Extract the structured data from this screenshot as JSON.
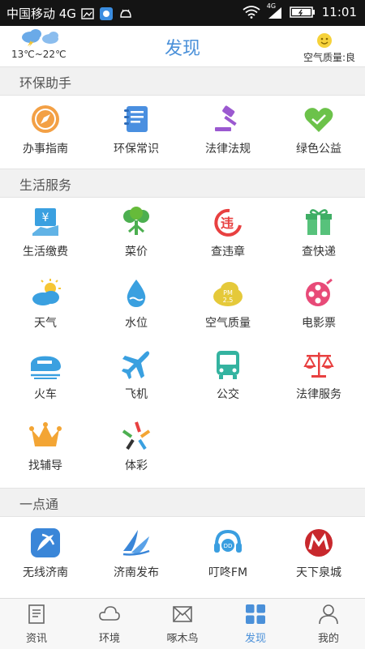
{
  "status_bar": {
    "carrier": "中国移动 4G",
    "time": "11:01",
    "network_label": "4G"
  },
  "header": {
    "title": "发现",
    "weather_range": "13℃~22℃",
    "air_quality": "空气质量:良"
  },
  "sections": [
    {
      "title": "环保助手",
      "items": [
        {
          "label": "办事指南",
          "icon": "compass-icon"
        },
        {
          "label": "环保常识",
          "icon": "notebook-icon"
        },
        {
          "label": "法律法规",
          "icon": "gavel-icon"
        },
        {
          "label": "绿色公益",
          "icon": "heart-handshake-icon"
        }
      ]
    },
    {
      "title": "生活服务",
      "items": [
        {
          "label": "生活缴费",
          "icon": "bill-payment-icon"
        },
        {
          "label": "菜价",
          "icon": "vegetable-icon"
        },
        {
          "label": "查违章",
          "icon": "traffic-violation-icon"
        },
        {
          "label": "查快递",
          "icon": "gift-box-icon"
        },
        {
          "label": "天气",
          "icon": "sun-cloud-icon"
        },
        {
          "label": "水位",
          "icon": "water-drop-icon"
        },
        {
          "label": "空气质量",
          "icon": "pm25-cloud-icon"
        },
        {
          "label": "电影票",
          "icon": "film-reel-icon"
        },
        {
          "label": "火车",
          "icon": "train-icon"
        },
        {
          "label": "飞机",
          "icon": "airplane-icon"
        },
        {
          "label": "公交",
          "icon": "bus-icon"
        },
        {
          "label": "法律服务",
          "icon": "scales-icon"
        },
        {
          "label": "找辅导",
          "icon": "crown-icon"
        },
        {
          "label": "体彩",
          "icon": "lottery-star-icon"
        }
      ]
    },
    {
      "title": "一点通",
      "items": [
        {
          "label": "无线济南",
          "icon": "wireless-jinan-icon"
        },
        {
          "label": "济南发布",
          "icon": "jinan-release-icon"
        },
        {
          "label": "叮咚FM",
          "icon": "dingdong-fm-icon"
        },
        {
          "label": "天下泉城",
          "icon": "quancheng-icon"
        }
      ]
    }
  ],
  "tabs": [
    {
      "label": "资讯",
      "icon": "news-icon",
      "active": false
    },
    {
      "label": "环境",
      "icon": "cloud-icon",
      "active": false
    },
    {
      "label": "啄木鸟",
      "icon": "envelope-icon",
      "active": false
    },
    {
      "label": "发现",
      "icon": "discover-grid-icon",
      "active": true
    },
    {
      "label": "我的",
      "icon": "profile-icon",
      "active": false
    }
  ],
  "colors": {
    "accent": "#4a90d9",
    "status_bar": "#141414",
    "section_bg": "#f1f1f1"
  }
}
